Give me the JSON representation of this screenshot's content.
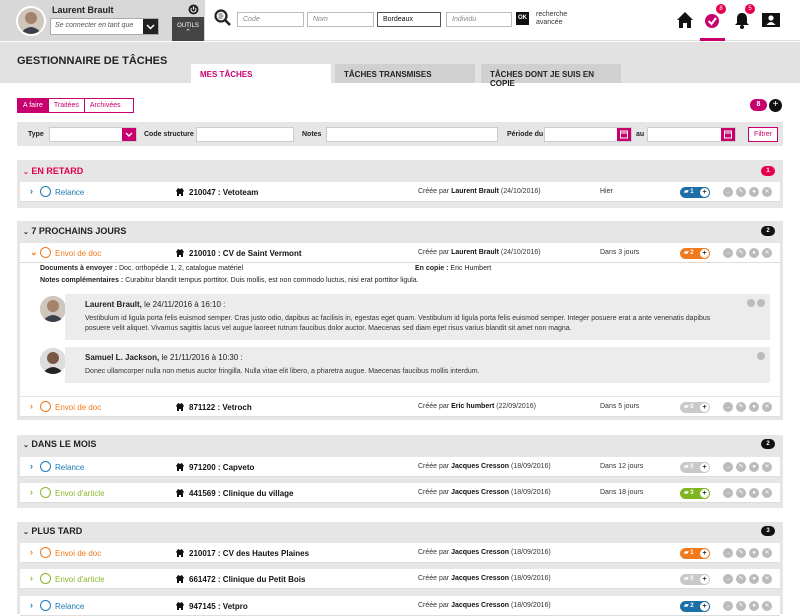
{
  "user": {
    "name": "Laurent Brault",
    "impersonate_placeholder": "Se connecter en tant que",
    "tools_label": "OUTILS"
  },
  "search": {
    "code_placeholder": "Code",
    "nom_placeholder": "Nom",
    "city_value": "Bordeaux",
    "individu_placeholder": "Individu",
    "advanced_button": "OK",
    "advanced_label": "recherche avancée"
  },
  "nav": {
    "tasks_badge": "8",
    "notif_badge": "5",
    "icons": [
      "home-icon",
      "tasks-icon",
      "bell-icon",
      "contacts-icon"
    ]
  },
  "header": {
    "title": "GESTIONNAIRE DE TÂCHES",
    "tabs": [
      "MES TÂCHES",
      "TÂCHES TRANSMISES",
      "TÂCHES DONT JE SUIS EN COPIE"
    ]
  },
  "status_tabs": [
    "A faire",
    "Traitées",
    "Archivées"
  ],
  "task_count": "8",
  "filters": {
    "type": "Type",
    "code": "Code structure",
    "notes": "Notes",
    "period": "Période du",
    "to": "au",
    "submit": "Filtrer"
  },
  "colors": {
    "accent": "#c8006e",
    "red": "#e5004c",
    "relance": "#1e7bb8",
    "envoi_doc": "#f07a1e",
    "envoi_article": "#8cb82b"
  },
  "sections": [
    {
      "title": "EN RETARD",
      "count": "1",
      "rows": [
        {
          "type": "Relance",
          "ref": "210047 : Vetoteam",
          "created_label": "Créée par",
          "creator": "Laurent Brault",
          "date": "(24/10/2016)",
          "when": "Hier",
          "comments": "1"
        }
      ]
    },
    {
      "title": "7 PROCHAINS JOURS",
      "count": "2",
      "rows": [
        {
          "type": "Envoi de doc",
          "ref": "210010 : CV de Saint Vermont",
          "created_label": "Créée par",
          "creator": "Laurent Brault",
          "date": "(24/10/2016)",
          "when": "Dans 3 jours",
          "comments": "2"
        },
        {
          "type": "Envoi de doc",
          "ref": "871122 : Vetroch",
          "created_label": "Créée par",
          "creator": "Eric humbert",
          "date": "(22/09/2016)",
          "when": "Dans 5 jours",
          "comments": "0"
        }
      ],
      "detail": {
        "docs_label": "Documents à envoyer :",
        "docs_value": "Doc. orthopédie 1, 2, catalogue matériel",
        "copy_label": "En copie :",
        "copy_value": "Eric Humbert",
        "notes_label": "Notes complémentaires :",
        "notes_value": "Curabitur blandit tempus porttitor. Duis mollis, est non commodo luctus, nisi erat porttitor ligula.",
        "comments": [
          {
            "author": "Laurent Brault,",
            "date": "le 24/11/2016 à 16:10 :",
            "text": "Vestibulum id ligula porta felis euismod semper. Cras justo odio, dapibus ac facilisis in, egestas eget quam. Vestibulum id ligula porta felis euismod semper. Integer posuere erat a ante venenatis dapibus posuere velit aliquet. Vivamus sagittis lacus vel augue laoreet rutrum faucibus dolor auctor. Maecenas sed diam eget risus varius blandit sit amet non magna."
          },
          {
            "author": "Samuel L. Jackson,",
            "date": "le 21/11/2016 à 10:30 :",
            "text": "Donec ullamcorper nulla non metus auctor fringilla. Nulla vitae elit libero, a pharetra augue. Maecenas faucibus mollis interdum."
          }
        ]
      }
    },
    {
      "title": "DANS LE MOIS",
      "count": "2",
      "rows": [
        {
          "type": "Relance",
          "ref": "971200 : Capveto",
          "created_label": "Créée par",
          "creator": "Jacques Cresson",
          "date": "(18/09/2016)",
          "when": "Dans 12 jours",
          "comments": "0"
        },
        {
          "type": "Envoi d'article",
          "ref": "441569 : Clinique du village",
          "created_label": "Créée par",
          "creator": "Jacques Cresson",
          "date": "(18/09/2016)",
          "when": "Dans 18 jours",
          "comments": "3"
        }
      ]
    },
    {
      "title": "PLUS TARD",
      "count": "3",
      "rows": [
        {
          "type": "Envoi de doc",
          "ref": "210017 : CV des Hautes Plaines",
          "created_label": "Créée par",
          "creator": "Jacques Cresson",
          "date": "(18/09/2016)",
          "when": "",
          "comments": "1"
        },
        {
          "type": "Envoi d'article",
          "ref": "661472 : Clinique du Petit Bois",
          "created_label": "Créée par",
          "creator": "Jacques Cresson",
          "date": "(18/09/2016)",
          "when": "",
          "comments": "0"
        },
        {
          "type": "Relance",
          "ref": "947145 : Vetpro",
          "created_label": "Créée par",
          "creator": "Jacques Cresson",
          "date": "(18/09/2016)",
          "when": "",
          "comments": "2"
        }
      ]
    }
  ]
}
